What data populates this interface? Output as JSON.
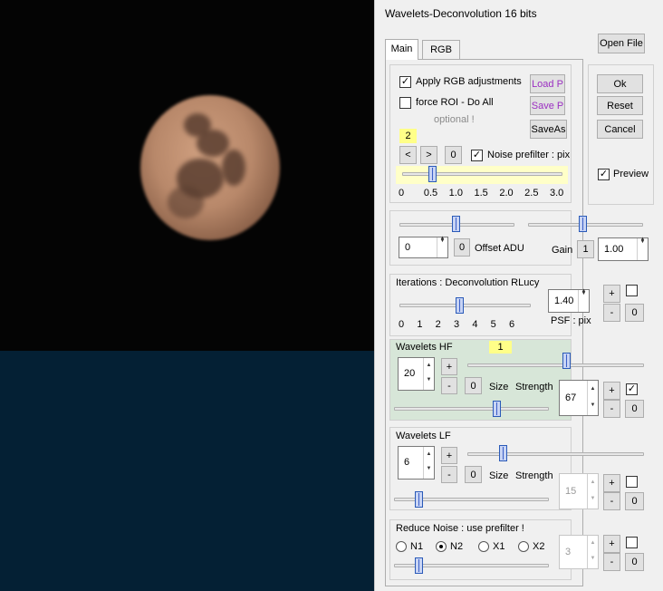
{
  "window": {
    "title": "Wavelets-Deconvolution 16 bits"
  },
  "tabs": [
    {
      "label": "Main"
    },
    {
      "label": "RGB"
    }
  ],
  "buttons": {
    "open_file": "Open File",
    "ok": "Ok",
    "reset": "Reset",
    "cancel": "Cancel",
    "load_p": "Load P",
    "save_p": "Save P",
    "save_as": "SaveAs",
    "prev": "<",
    "next": ">",
    "noise_zero": "0",
    "offset_zero": "0",
    "gain_one": "1",
    "plus": "+",
    "minus": "-",
    "zero": "0"
  },
  "colors": {
    "accent_purple": "#9b2fc2",
    "highlight_yellow": "#ffff88",
    "hf_panel_green": "#d7e6d8"
  },
  "rgb_section": {
    "apply_rgb_label": "Apply RGB adjustments",
    "apply_rgb_checked": true,
    "force_roi_label": "force ROI - Do All",
    "force_roi_checked": false,
    "optional_label": "optional !",
    "preset_index": "2",
    "noise_prefilter_label": "Noise prefilter : pix",
    "noise_prefilter_checked": true,
    "noise_ticks": [
      "0",
      "0.5",
      "1.0",
      "1.5",
      "2.0",
      "2.5",
      "3.0"
    ],
    "noise_value": 0.6
  },
  "preview": {
    "label": "Preview",
    "checked": true
  },
  "offset_gain": {
    "offset_value": "0",
    "offset_label": "Offset ADU",
    "gain_label": "Gain",
    "gain_value": "1.00"
  },
  "iterations": {
    "title": "Iterations : Deconvolution RLucy",
    "ticks": [
      "0",
      "1",
      "2",
      "3",
      "4",
      "5",
      "6"
    ],
    "value": 3,
    "psf_value": "1.40",
    "psf_label": "PSF : pix"
  },
  "wavelets_hf": {
    "title": "Wavelets HF",
    "badge": "1",
    "size_value": "20",
    "size_label": "Size",
    "strength_label": "Strength",
    "strength_value": "67",
    "enabled": true
  },
  "wavelets_lf": {
    "title": "Wavelets LF",
    "size_value": "6",
    "size_label": "Size",
    "strength_label": "Strength",
    "strength_value": "15",
    "enabled": false
  },
  "reduce_noise": {
    "title": "Reduce Noise : use prefilter !",
    "options": [
      "N1",
      "N2",
      "X1",
      "X2"
    ],
    "selected": "N2",
    "value": "3",
    "enabled": false
  }
}
